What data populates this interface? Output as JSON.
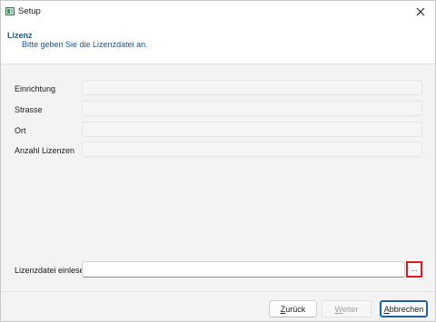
{
  "window": {
    "title": "Setup",
    "icon": "app-icon"
  },
  "header": {
    "title": "Lizenz",
    "subtitle": "Bitte geben Sie die Lizenzdatei an."
  },
  "form": {
    "fields": [
      {
        "label": "Einrichtung",
        "value": ""
      },
      {
        "label": "Strasse",
        "value": ""
      },
      {
        "label": "Ort",
        "value": ""
      },
      {
        "label": "Anzahl Lizenzen",
        "value": ""
      }
    ],
    "license_file": {
      "label": "Lizenzdatei einlesen",
      "value": "",
      "browse_label": "..."
    }
  },
  "buttons": {
    "back": {
      "underlined": "Z",
      "rest": "urück"
    },
    "next": {
      "underlined": "W",
      "rest": "eiter"
    },
    "cancel": {
      "underlined": "A",
      "rest": "bbrechen"
    }
  },
  "colors": {
    "header_text": "#0a5aa8",
    "highlight": "#e0191e",
    "default_button_border": "#1f5fa8"
  }
}
